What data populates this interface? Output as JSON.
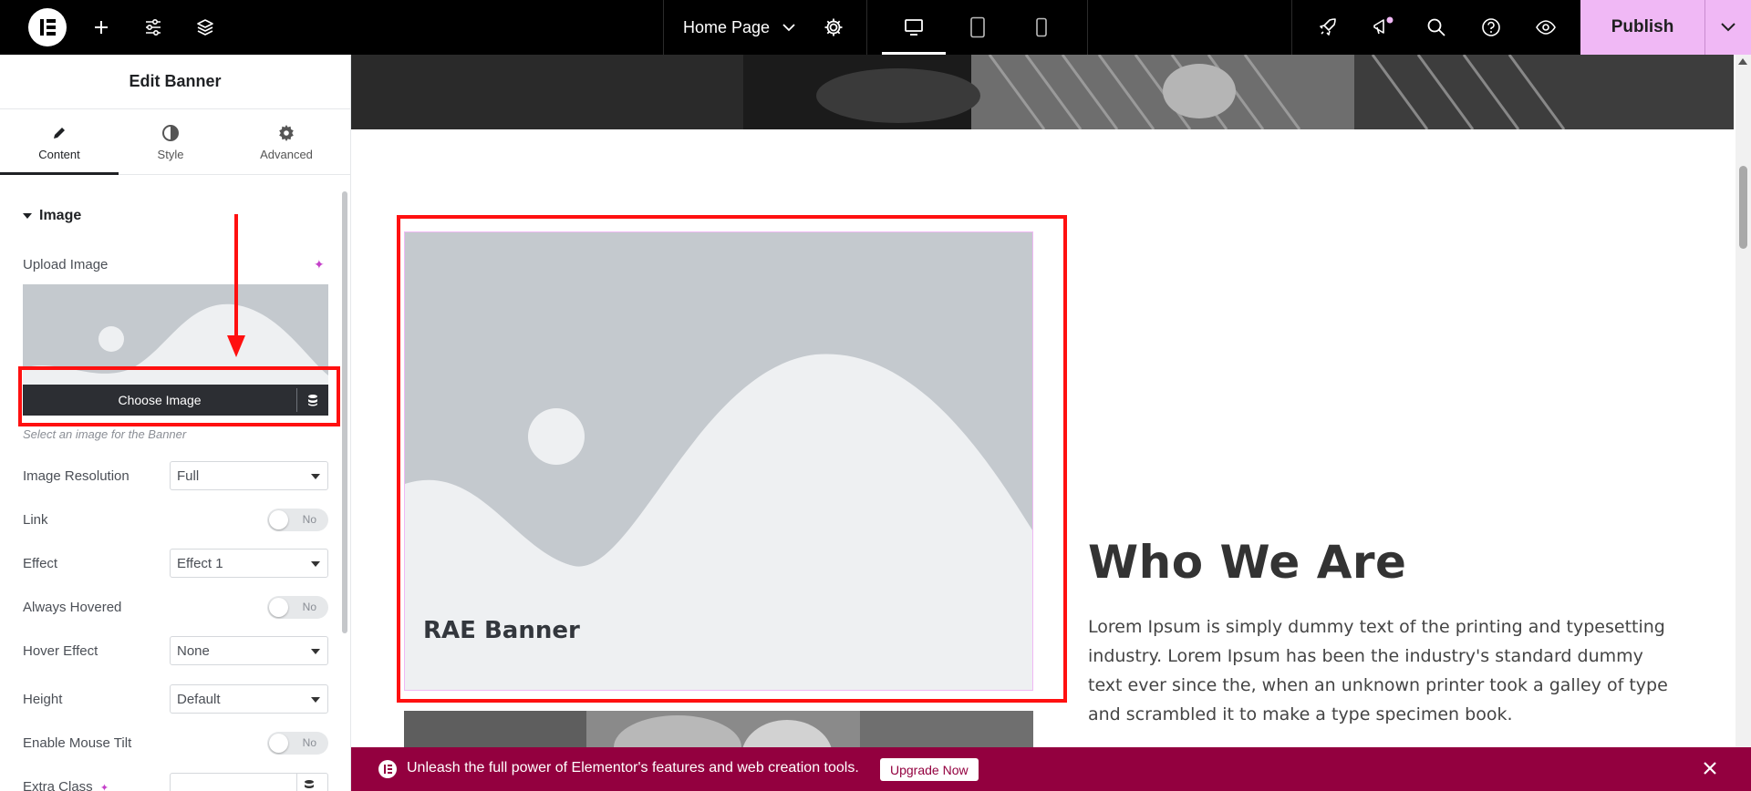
{
  "topbar": {
    "page_name": "Home Page",
    "publish_label": "Publish",
    "icons": [
      "elementor-logo-icon",
      "add-icon",
      "sliders-icon",
      "layers-icon",
      "chevron-down-icon",
      "gear-icon",
      "desktop-icon",
      "tablet-icon",
      "mobile-icon",
      "rocket-icon",
      "megaphone-icon",
      "search-icon",
      "help-icon",
      "eye-icon"
    ]
  },
  "panel": {
    "title": "Edit Banner",
    "tabs": [
      {
        "label": "Content",
        "icon": "pencil-icon",
        "active": true
      },
      {
        "label": "Style",
        "icon": "contrast-icon",
        "active": false
      },
      {
        "label": "Advanced",
        "icon": "gear-icon",
        "active": false
      }
    ],
    "section_title": "Image",
    "upload_label": "Upload Image",
    "choose_image_label": "Choose Image",
    "hint": "Select an image for the Banner",
    "controls": {
      "image_resolution": {
        "label": "Image Resolution",
        "value": "Full"
      },
      "link": {
        "label": "Link",
        "value": "No"
      },
      "effect": {
        "label": "Effect",
        "value": "Effect 1"
      },
      "always_hovered": {
        "label": "Always Hovered",
        "value": "No"
      },
      "hover_effect": {
        "label": "Hover Effect",
        "value": "None"
      },
      "height": {
        "label": "Height",
        "value": "Default"
      },
      "mouse_tilt": {
        "label": "Enable Mouse Tilt",
        "value": "No"
      },
      "extra_class": {
        "label": "Extra Class",
        "value": ""
      }
    }
  },
  "canvas": {
    "banner_title": "RAE Banner",
    "section_heading": "Who We Are",
    "section_text": "Lorem Ipsum is simply dummy text of the printing and typesetting industry. Lorem Ipsum has been the industry's standard dummy text ever since the, when an unknown printer took a galley of type and scrambled it to make a type specimen book."
  },
  "promo": {
    "text": "Unleash the full power of Elementor's features and web creation tools.",
    "button": "Upgrade Now"
  },
  "colors": {
    "accent": "#f0b8f5",
    "promo": "#93003f",
    "annotation": "#ff1010"
  }
}
